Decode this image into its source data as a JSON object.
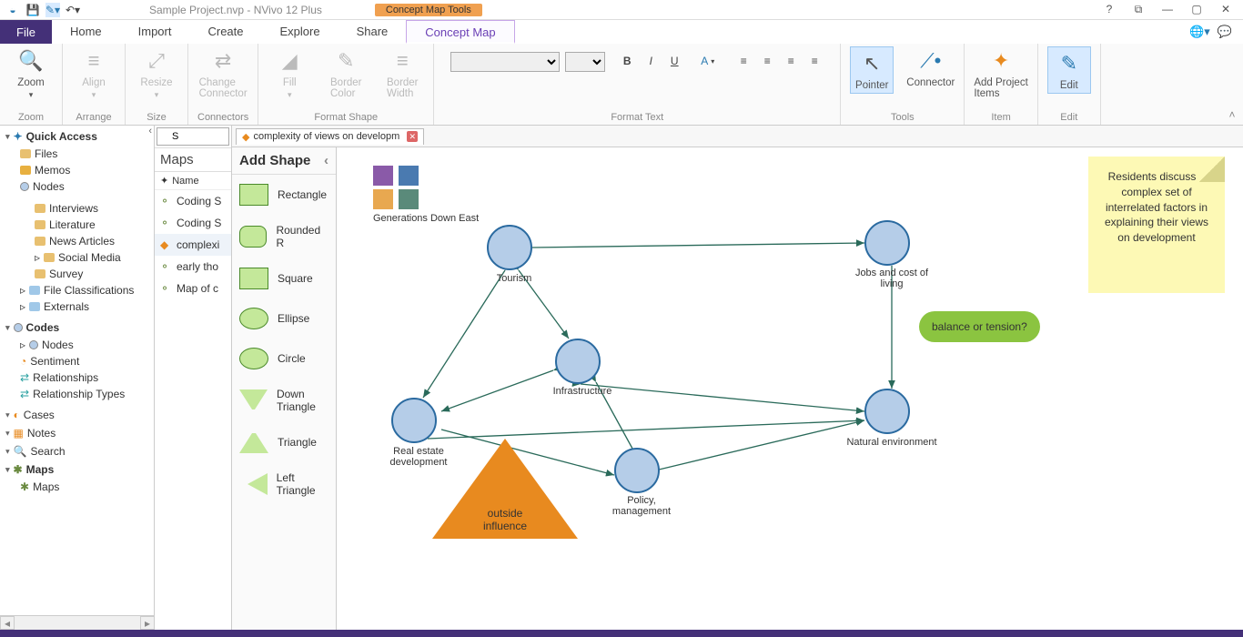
{
  "title": "Sample Project.nvp - NVivo 12 Plus",
  "context_tools": "Concept Map Tools",
  "tabs": {
    "file": "File",
    "home": "Home",
    "import": "Import",
    "create": "Create",
    "explore": "Explore",
    "share": "Share",
    "conceptmap": "Concept Map"
  },
  "ribbon": {
    "zoom": {
      "label": "Zoom",
      "group": "Zoom"
    },
    "align": {
      "label": "Align",
      "group": "Arrange"
    },
    "resize": {
      "label": "Resize",
      "group": "Size"
    },
    "changeconn": {
      "label": "Change\nConnector",
      "group": "Connectors"
    },
    "fill": {
      "label": "Fill"
    },
    "bordercolor": {
      "label": "Border\nColor"
    },
    "borderwidth": {
      "label": "Border\nWidth"
    },
    "formatshape_group": "Format Shape",
    "formattext_group": "Format Text",
    "pointer": {
      "label": "Pointer"
    },
    "connector": {
      "label": "Connector"
    },
    "tools_group": "Tools",
    "additems": {
      "label": "Add Project\nItems",
      "group": "Item"
    },
    "edit": {
      "label": "Edit",
      "group": "Edit"
    }
  },
  "nav": {
    "quickaccess": "Quick Access",
    "files": "Files",
    "memos": "Memos",
    "nodes": "Nodes",
    "interviews": "Interviews",
    "literature": "Literature",
    "newsarticles": "News Articles",
    "socialmedia": "Social Media",
    "survey": "Survey",
    "fileclass": "File Classifications",
    "externals": "Externals",
    "codes": "Codes",
    "nodes2": "Nodes",
    "sentiment": "Sentiment",
    "relationships": "Relationships",
    "reltypes": "Relationship Types",
    "cases": "Cases",
    "notes": "Notes",
    "search": "Search",
    "maps": "Maps",
    "maps_item": "Maps"
  },
  "mapslist": {
    "head": "Maps",
    "search": "S",
    "colhead": "Name",
    "rows": [
      "Coding S",
      "Coding S",
      "complexi",
      "early tho",
      "Map of c"
    ]
  },
  "doctab": "complexity of views on developm",
  "palette": {
    "head": "Add Shape",
    "items": [
      "Rectangle",
      "Rounded R",
      "Square",
      "Ellipse",
      "Circle",
      "Down Triangle",
      "Triangle",
      "Left Triangle"
    ]
  },
  "canvas": {
    "legend": "Generations Down East",
    "nodes": {
      "tourism": "Tourism",
      "jobs": "Jobs and cost of living",
      "infra": "Infrastructure",
      "realestate": "Real estate development",
      "nat": "Natural environment",
      "policy": "Policy, management"
    },
    "bubble": "balance or tension?",
    "triangle": "outside influence",
    "sticky": "Residents discuss a complex set of interrelated factors in explaining their views on development"
  }
}
